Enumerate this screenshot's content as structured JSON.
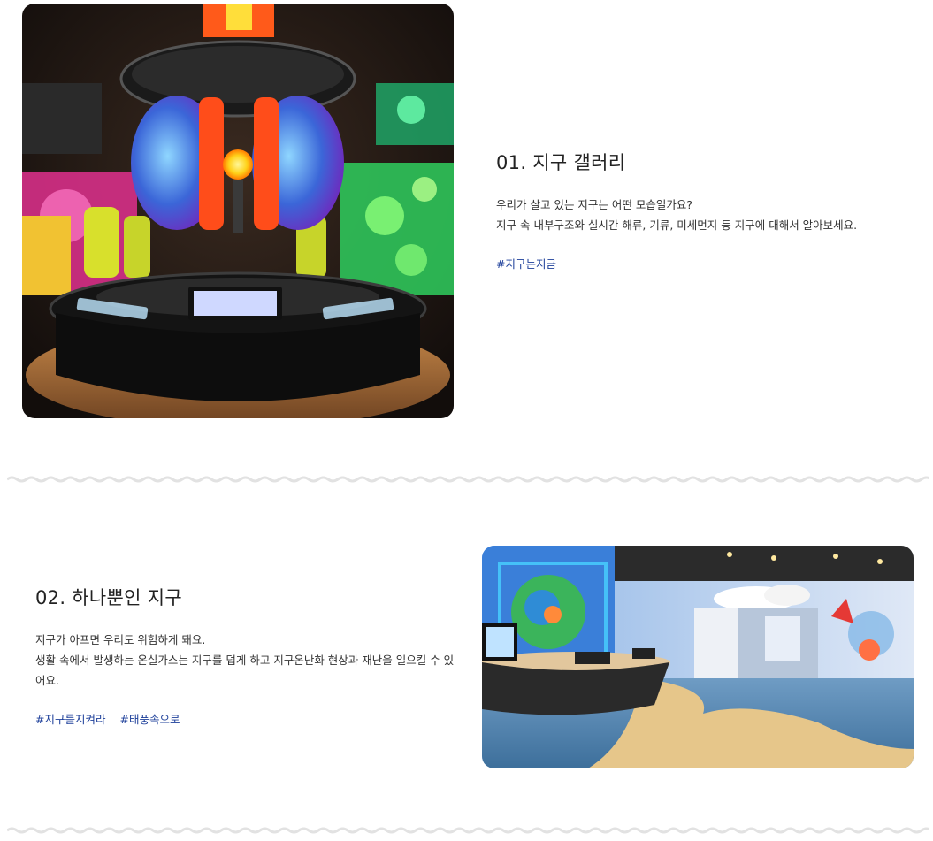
{
  "sections": [
    {
      "number_title": "01. 지구 갤러리",
      "desc_lines": [
        "우리가 살고 있는 지구는 어떤 모습일가요?",
        "지구 속 내부구조와 실시간 해류, 기류, 미세먼지 등 지구에 대해서 알아보세요."
      ],
      "tags": [
        "#지구는지금"
      ]
    },
    {
      "number_title": "02. 하나뿐인 지구",
      "desc_lines": [
        "지구가 아프면 우리도 위험하게 돼요.",
        "생활 속에서 발생하는 온실가스는 지구를 덥게 하고 지구온난화 현상과 재난을 일으킬 수 있어요."
      ],
      "tags": [
        "#지구를지켜라",
        "#태풍속으로"
      ]
    }
  ],
  "colors": {
    "tag": "#1d3f9a",
    "wave": "#e2e2e2"
  }
}
